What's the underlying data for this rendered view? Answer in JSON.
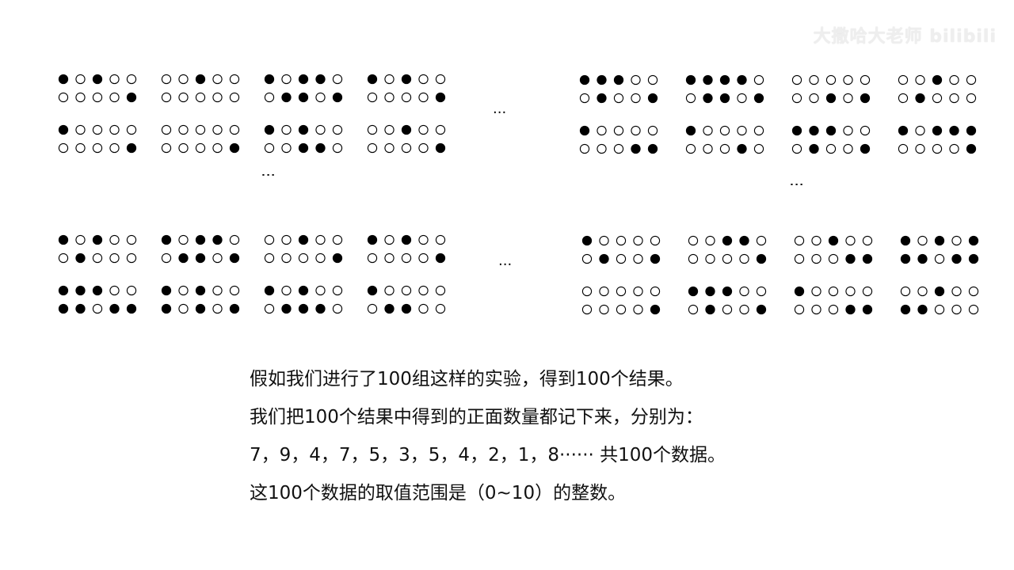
{
  "watermark": {
    "text": "大撒哈大老师 bilibili"
  },
  "ellipsis": {
    "horizontal": "···",
    "vertical": "⋮"
  },
  "experiments": {
    "top_left": [
      [
        "10100",
        "00001",
        "10000",
        "00001"
      ],
      [
        "00100",
        "00000",
        "00000",
        "00001"
      ],
      [
        "10110",
        "01101",
        "10100",
        "00110"
      ],
      [
        "10100",
        "00001",
        "00100",
        "00001"
      ]
    ],
    "top_right": [
      [
        "11100",
        "01001",
        "10000",
        "00011"
      ],
      [
        "11110",
        "01101",
        "10000",
        "00010"
      ],
      [
        "00000",
        "00101",
        "11100",
        "01001"
      ],
      [
        "00100",
        "01000",
        "10111",
        "00001"
      ]
    ],
    "bottom_left": [
      [
        "10100",
        "01000",
        "11100",
        "11011"
      ],
      [
        "10110",
        "01101",
        "10100",
        "10101"
      ],
      [
        "00100",
        "00001",
        "10100",
        "01110"
      ],
      [
        "10100",
        "00001",
        "10000",
        "01100"
      ]
    ],
    "bottom_right": [
      [
        "10000",
        "01001",
        "00000",
        "00001"
      ],
      [
        "00110",
        "00001",
        "11100",
        "01001"
      ],
      [
        "00100",
        "00011",
        "10000",
        "00011"
      ],
      [
        "10101",
        "11011",
        "00100",
        "11000"
      ]
    ]
  },
  "caption": {
    "line1": "假如我们进行了100组这样的实验，得到100个结果。",
    "line2": "我们把100个结果中得到的正面数量都记下来，分别为：",
    "line3": "7，9，4，7，5，3，5，4，2，1，8······  共100个数据。",
    "line4": "这100个数据的取值范围是（0~10）的整数。"
  },
  "colors": {
    "filled": "#000000",
    "empty": "#ffffff",
    "stroke": "#000000"
  }
}
